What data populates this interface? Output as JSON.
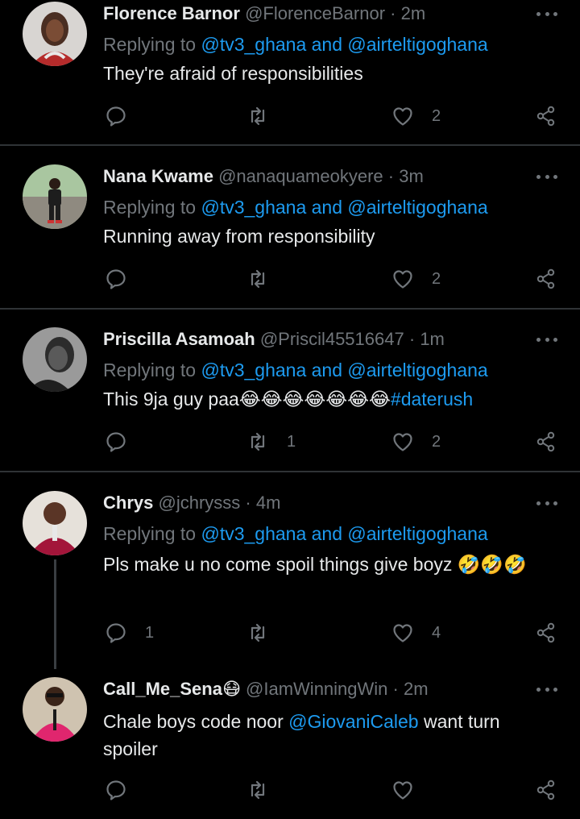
{
  "tweets": [
    {
      "name": "Florence Barnor",
      "handle": "@FlorenceBarnor",
      "time": "2m",
      "replying_prefix": "Replying to",
      "replying_to_1": "@tv3_ghana",
      "replying_and": "and",
      "replying_to_2": "@airteltigoghana",
      "text": "They're afraid of responsibilities",
      "reply_count": "",
      "retweet_count": "",
      "like_count": "2"
    },
    {
      "name": "Nana Kwame",
      "handle": "@nanaquameokyere",
      "time": "3m",
      "replying_prefix": "Replying to",
      "replying_to_1": "@tv3_ghana",
      "replying_and": "and",
      "replying_to_2": "@airteltigoghana",
      "text": "Running away from responsibility",
      "reply_count": "",
      "retweet_count": "",
      "like_count": "2"
    },
    {
      "name": "Priscilla Asamoah",
      "handle": "@Priscil45516647",
      "time": "1m",
      "replying_prefix": "Replying to",
      "replying_to_1": "@tv3_ghana",
      "replying_and": "and",
      "replying_to_2": "@airteltigoghana",
      "text": "This 9ja guy paa",
      "emojis": "😂😂😂😂😂😂😂",
      "hashtag": "#daterush",
      "reply_count": "",
      "retweet_count": "1",
      "like_count": "2"
    },
    {
      "name": "Chrys",
      "handle": "@jchrysss",
      "time": "4m",
      "replying_prefix": "Replying to",
      "replying_to_1": "@tv3_ghana",
      "replying_and": "and",
      "replying_to_2": "@airteltigoghana",
      "text": "Pls make u no come spoil things give boyz",
      "emojis": "🤣🤣🤣",
      "reply_count": "1",
      "retweet_count": "",
      "like_count": "4"
    },
    {
      "name": "Call_Me_Sena",
      "name_emoji": "😷",
      "handle": "@IamWinningWin",
      "time": "2m",
      "text_before": "Chale boys code noor",
      "mention": "@GiovaniCaleb",
      "text_after": "want turn spoiler",
      "reply_count": "",
      "retweet_count": "",
      "like_count": ""
    }
  ],
  "dot_separator": "·",
  "colors": {
    "background": "#000000",
    "text": "#e7e9ea",
    "muted": "#71767b",
    "link": "#1d9bf0",
    "divider": "#2f3336"
  },
  "icons": [
    "reply-icon",
    "retweet-icon",
    "like-icon",
    "share-icon",
    "more-icon"
  ]
}
